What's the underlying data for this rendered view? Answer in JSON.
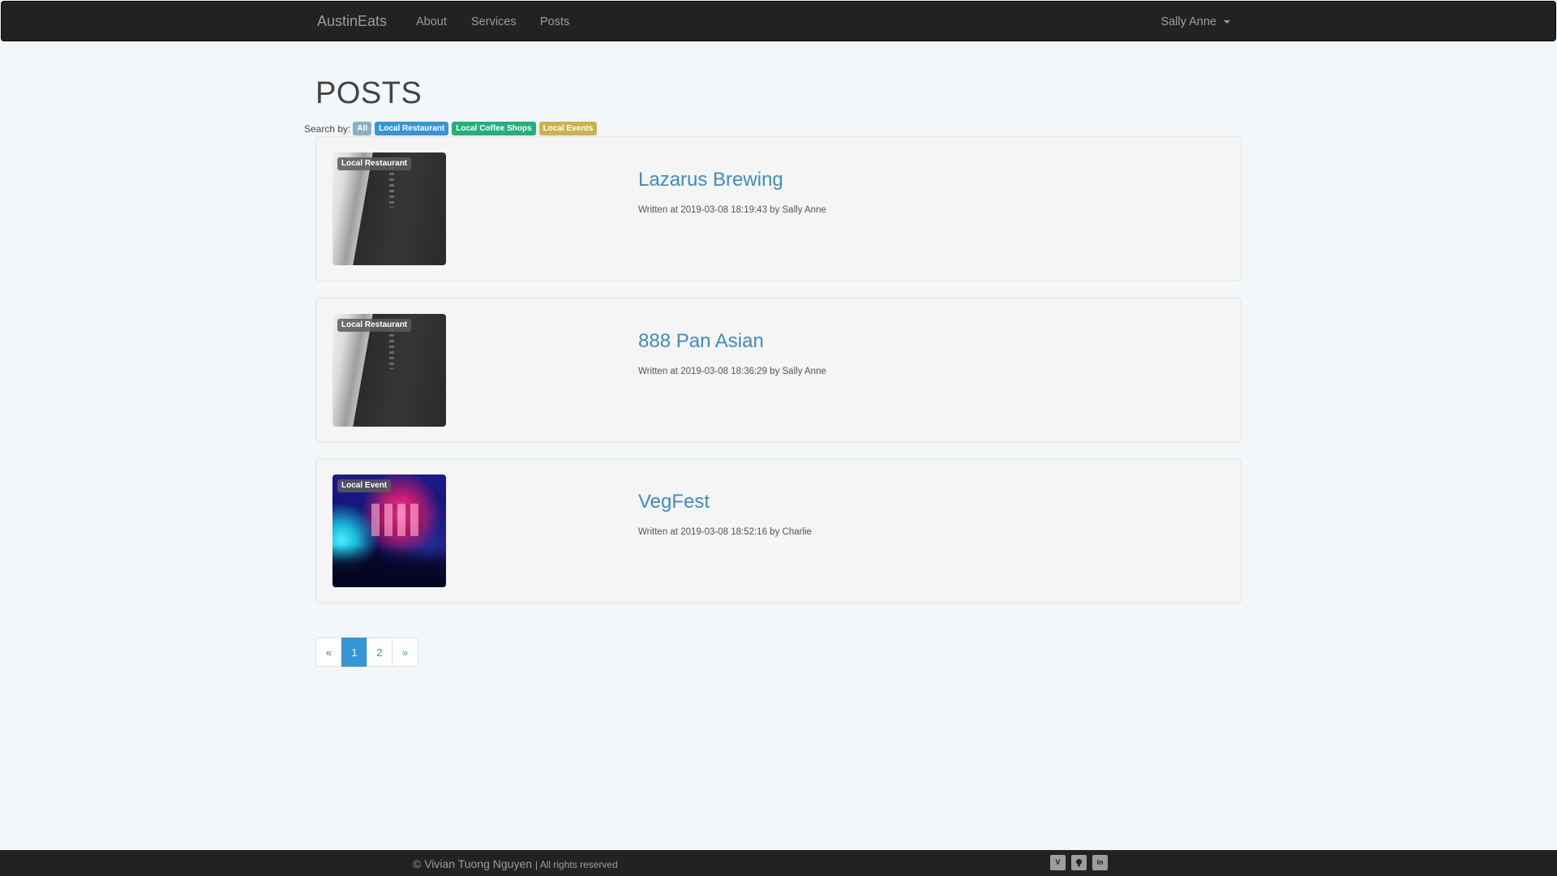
{
  "nav": {
    "brand": "AustinEats",
    "links": [
      "About",
      "Services",
      "Posts"
    ],
    "user": "Sally Anne"
  },
  "page": {
    "title": "POSTS",
    "search_label": "Search by:",
    "filters": [
      "All",
      "Local Restaurant",
      "Local Coffee Shops",
      "Local Events"
    ]
  },
  "posts": [
    {
      "badge": "Local Restaurant",
      "title": "Lazarus Brewing",
      "meta": "Written at 2019-03-08 18:19:43 by Sally Anne"
    },
    {
      "badge": "Local Restaurant",
      "title": "888 Pan Asian",
      "meta": "Written at 2019-03-08 18:36:29 by Sally Anne"
    },
    {
      "badge": "Local Event",
      "title": "VegFest",
      "meta": "Written at 2019-03-08 18:52:16 by Charlie"
    }
  ],
  "pagination": {
    "prev": "«",
    "pages": [
      "1",
      "2"
    ],
    "next": "»",
    "current": "1"
  },
  "footer": {
    "copyright": "© Vivian Tuong Nguyen",
    "rights": "| All rights reserved",
    "icons": [
      "vimeo-icon",
      "github-icon",
      "linkedin-icon"
    ]
  },
  "colors": {
    "accent": "#3596d6",
    "nav_bg": "#222222",
    "coffee": "#22b07d",
    "events": "#cbb24a"
  }
}
